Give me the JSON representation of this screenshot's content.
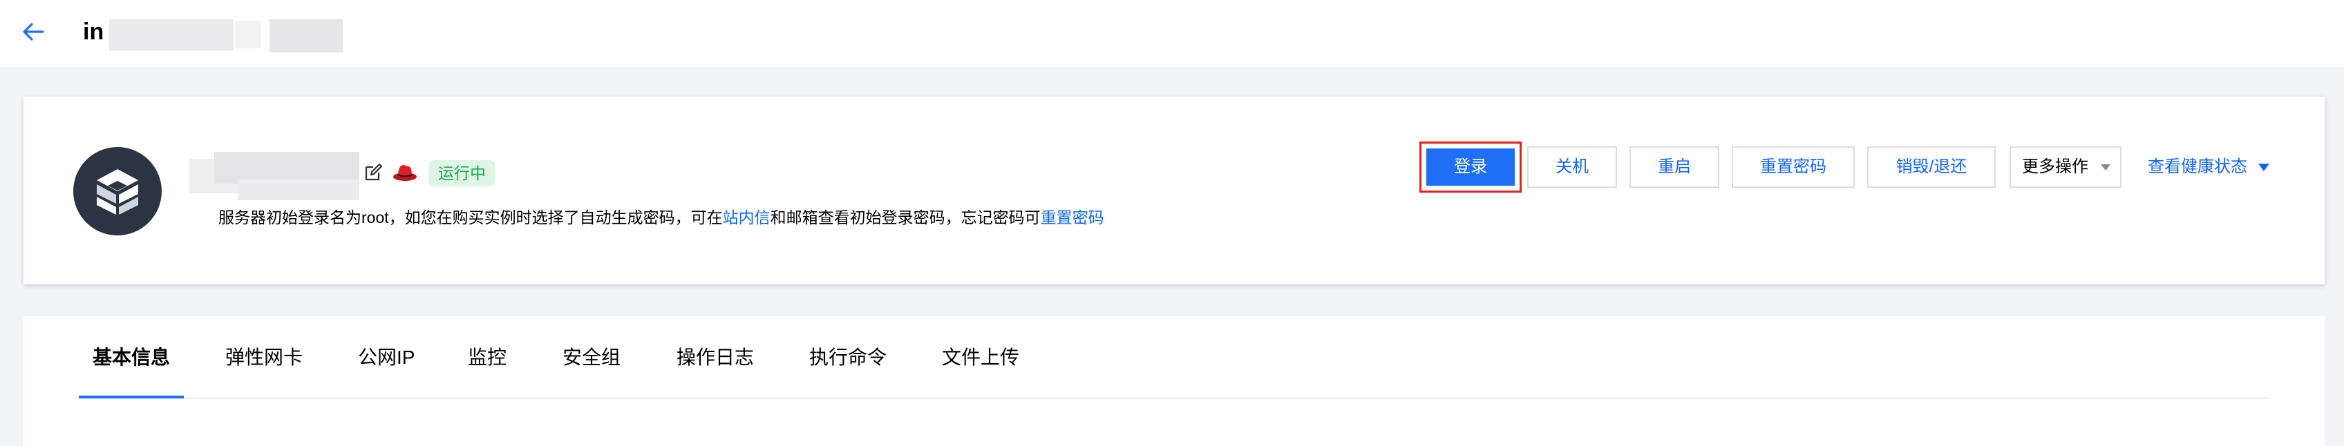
{
  "header": {
    "title_visible": "in",
    "back_icon": "arrow-left-icon"
  },
  "instance": {
    "os_icon": "redhat-icon",
    "status": "运行中",
    "notice": {
      "prefix": "服务器初始登录名为root，如您在购买实例时选择了自动生成密码，可在",
      "link_inbox": "站内信",
      "middle": "和邮箱查看初始登录密码，忘记密码可",
      "link_reset": "重置密码"
    },
    "actions": {
      "login": "登录",
      "shutdown": "关机",
      "restart": "重启",
      "reset_password": "重置密码",
      "destroy": "销毁/退还",
      "more": "更多操作",
      "health": "查看健康状态"
    }
  },
  "tabs": [
    {
      "label": "基本信息",
      "active": true
    },
    {
      "label": "弹性网卡"
    },
    {
      "label": "公网IP"
    },
    {
      "label": "监控"
    },
    {
      "label": "安全组"
    },
    {
      "label": "操作日志"
    },
    {
      "label": "执行命令"
    },
    {
      "label": "文件上传"
    }
  ],
  "colors": {
    "primary": "#1e6ff5",
    "link": "#1364f0",
    "status_green": "#1fa74f",
    "highlight_red": "#e0221d"
  }
}
